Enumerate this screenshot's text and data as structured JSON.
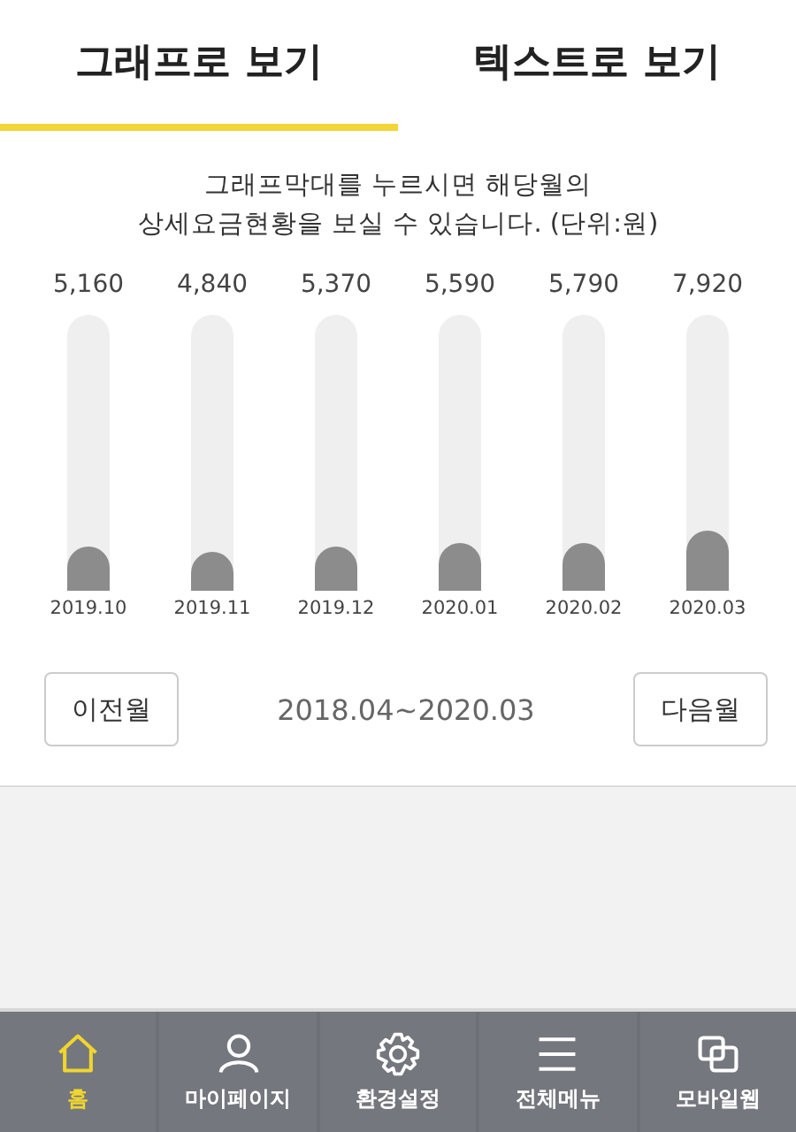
{
  "tabs": [
    {
      "label": "그래프로 보기",
      "selected": true
    },
    {
      "label": "텍스트로 보기",
      "selected": false
    }
  ],
  "notice_lines": [
    "그래프막대를 누르시면 해당월의",
    "상세요금현황을 보실 수 있습니다. (단위:원)"
  ],
  "months": [
    {
      "amount": "5,160",
      "month": "2019.10",
      "level": 0.16
    },
    {
      "amount": "4,840",
      "month": "2019.11",
      "level": 0.14
    },
    {
      "amount": "5,370",
      "month": "2019.12",
      "level": 0.16
    },
    {
      "amount": "5,590",
      "month": "2020.01",
      "level": 0.17
    },
    {
      "amount": "5,790",
      "month": "2020.02",
      "level": 0.17
    },
    {
      "amount": "7,920",
      "month": "2020.03",
      "level": 0.22
    }
  ],
  "period": {
    "prev_button": "이전월",
    "range": "2018.04~2020.03",
    "next_button": "다음월"
  },
  "nav": [
    {
      "label": "홈",
      "selected": true
    },
    {
      "label": "마이페이지",
      "selected": false
    },
    {
      "label": "환경설정",
      "selected": false
    },
    {
      "label": "전체메뉴",
      "selected": false
    },
    {
      "label": "모바일웹",
      "selected": false
    }
  ]
}
